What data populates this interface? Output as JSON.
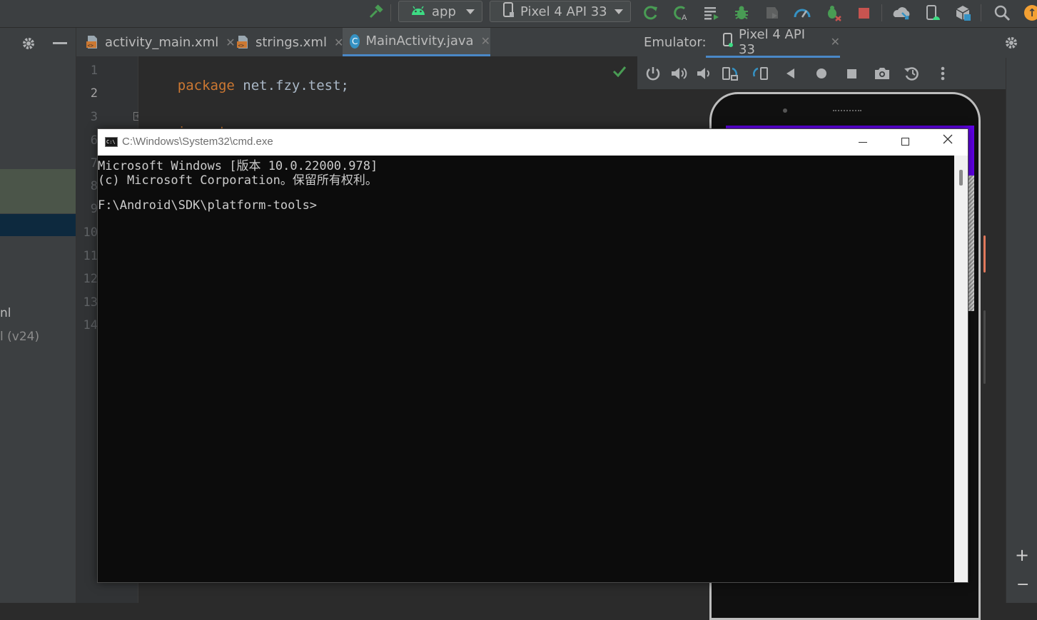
{
  "toolbar": {
    "run_config": "app",
    "device": "Pixel 4 API 33",
    "icons": [
      "hammer-icon",
      "android-icon",
      "rerun-icon",
      "apply-changes-icon",
      "profile-list-icon",
      "debug-icon",
      "coverage-icon",
      "profiler-icon",
      "attach-debugger-icon",
      "stop-icon",
      "sync-icon",
      "device-manager-icon",
      "sdk-manager-icon",
      "search-icon",
      "update-icon"
    ]
  },
  "left_panel": {
    "items": [
      "nl",
      "l (v24)"
    ]
  },
  "editor": {
    "tabs": [
      {
        "label": "activity_main.xml",
        "active": false
      },
      {
        "label": "strings.xml",
        "active": false
      },
      {
        "label": "MainActivity.java",
        "active": true
      }
    ],
    "line_numbers": [
      "1",
      "2",
      "3",
      "6",
      "7",
      "8",
      "9",
      "10",
      "11",
      "12",
      "13",
      "14"
    ],
    "code": {
      "line1_keyword": "package",
      "line1_rest": " net.fzy.test;",
      "line3_keyword": "import",
      "line3_rest": " ..."
    }
  },
  "emulator": {
    "label": "Emulator:",
    "device_tab": "Pixel 4 API 33",
    "controls": [
      "power-icon",
      "volume-up-icon",
      "volume-down-icon",
      "rotate-left-icon",
      "rotate-right-icon",
      "back-icon",
      "home-icon",
      "overview-icon",
      "screenshot-icon",
      "snapshot-icon",
      "more-icon"
    ]
  },
  "cmd": {
    "title": "C:\\Windows\\System32\\cmd.exe",
    "lines": [
      "Microsoft Windows [版本 10.0.22000.978]",
      "(c) Microsoft Corporation。保留所有权利。",
      "",
      "F:\\Android\\SDK\\platform-tools>"
    ]
  },
  "right_strip": {
    "zoom_in": "+",
    "zoom_out": "−"
  },
  "colors": {
    "keyword": "#cc7832",
    "text": "#a9b7c6",
    "accent_purple": "#6200ee",
    "run_green": "#499c54",
    "stop_red": "#c75450"
  }
}
